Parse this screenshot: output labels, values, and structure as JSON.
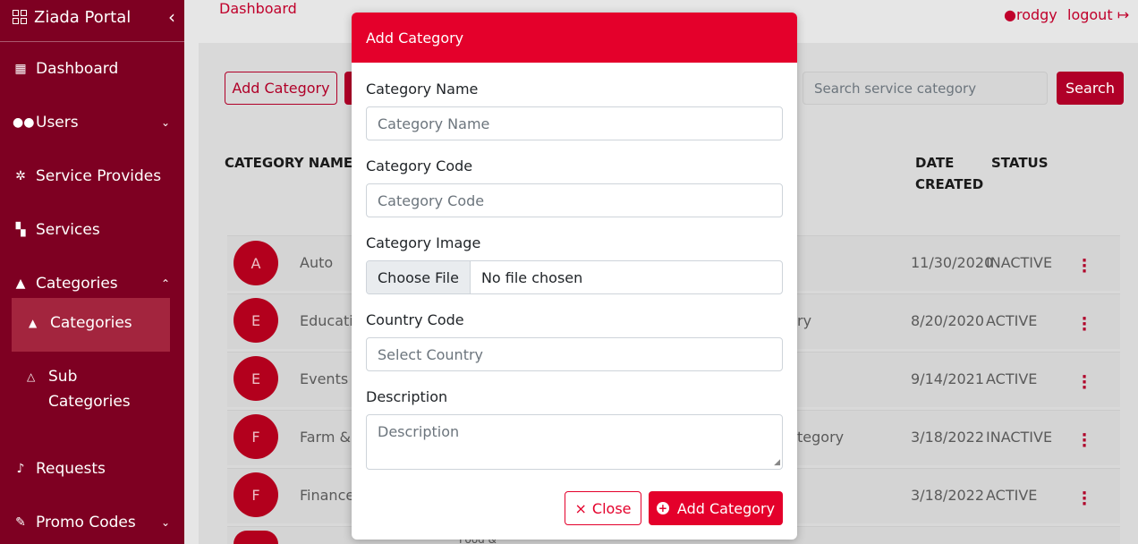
{
  "sidebar": {
    "brand": "Ziada Portal",
    "items": [
      {
        "label": "Dashboard",
        "icon": "dashboard-icon"
      },
      {
        "label": "Users",
        "icon": "users-icon"
      },
      {
        "label": "Service Provides",
        "icon": "gear-icon"
      },
      {
        "label": "Services",
        "icon": "map-icon"
      },
      {
        "label": "Categories",
        "icon": "shapes-icon"
      },
      {
        "label": "Requests",
        "icon": "bell-icon"
      },
      {
        "label": "Promo Codes",
        "icon": "pencil-icon"
      }
    ],
    "sub_items": [
      {
        "label": "Categories"
      },
      {
        "label": "Sub Categories"
      }
    ]
  },
  "header": {
    "breadcrumb": "Dashboard",
    "user": "rodgy",
    "logout": "logout"
  },
  "toolbar": {
    "add_category": "Add Category",
    "search_placeholder": "Search service category",
    "search_button": "Search"
  },
  "table": {
    "headers": {
      "category_name": "CATEGORY NAME",
      "date_created_1": "DATE",
      "date_created_2": "CREATED",
      "status": "STATUS"
    },
    "rows": [
      {
        "initial": "A",
        "name": "Auto",
        "desc": "",
        "date": "11/30/2020",
        "status": "INACTIVE"
      },
      {
        "initial": "E",
        "name": "Educatio",
        "desc": "ry",
        "date": "8/20/2020",
        "status": "ACTIVE"
      },
      {
        "initial": "E",
        "name": "Events",
        "desc": "",
        "date": "9/14/2021",
        "status": "ACTIVE"
      },
      {
        "initial": "F",
        "name": "Farm & C",
        "desc": "tegory",
        "date": "3/18/2022",
        "status": "INACTIVE"
      },
      {
        "initial": "F",
        "name": "Finance",
        "desc": "",
        "date": "3/18/2022",
        "status": "ACTIVE"
      }
    ],
    "partial_text": "Food &"
  },
  "modal": {
    "title": "Add Category",
    "fields": {
      "category_name_label": "Category Name",
      "category_name_placeholder": "Category Name",
      "category_code_label": "Category Code",
      "category_code_placeholder": "Category Code",
      "category_image_label": "Category Image",
      "choose_file": "Choose File",
      "no_file": "No file chosen",
      "country_code_label": "Country Code",
      "country_placeholder": "Select Country",
      "description_label": "Description",
      "description_placeholder": "Description"
    },
    "close_label": "Close",
    "submit_label": "Add Category"
  },
  "colors": {
    "sidebar_bg": "#7e0022",
    "accent": "#e4002b",
    "dark_accent": "#b00028"
  }
}
